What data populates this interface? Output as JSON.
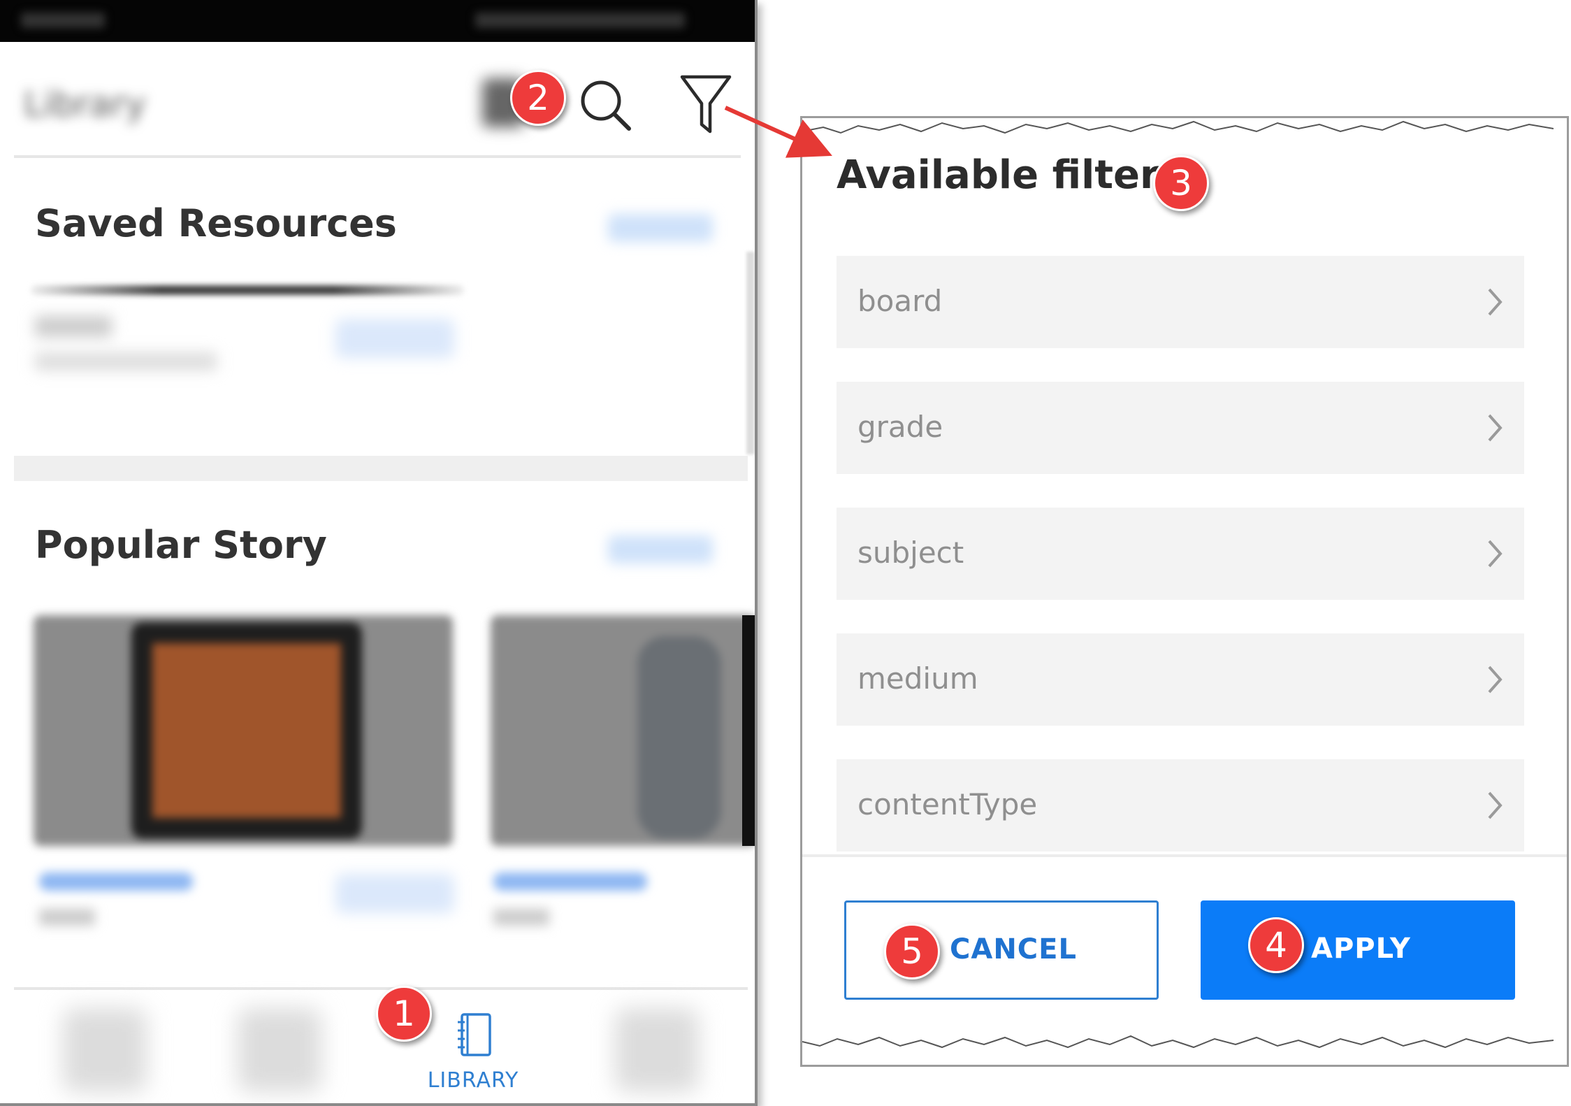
{
  "phone": {
    "header": {
      "title": "Library",
      "search_icon": "search-icon",
      "filter_icon": "filter-icon"
    },
    "sections": {
      "saved_title": "Saved Resources",
      "popular_title": "Popular Story"
    },
    "bottom_nav": {
      "library_label": "LIBRARY",
      "library_icon": "notebook-icon"
    }
  },
  "filter_dialog": {
    "title": "Available filters",
    "filters": [
      {
        "label": "board"
      },
      {
        "label": "grade"
      },
      {
        "label": "subject"
      },
      {
        "label": "medium"
      },
      {
        "label": "contentType"
      }
    ],
    "cancel_label": "CANCEL",
    "apply_label": "APPLY"
  },
  "annotations": {
    "markers": [
      "1",
      "2",
      "3",
      "4",
      "5"
    ],
    "marker_color": "#ee3b3b"
  },
  "colors": {
    "accent_blue": "#0b7cf8",
    "link_blue": "#2f7fd1",
    "filter_row_bg": "#f3f3f3"
  }
}
